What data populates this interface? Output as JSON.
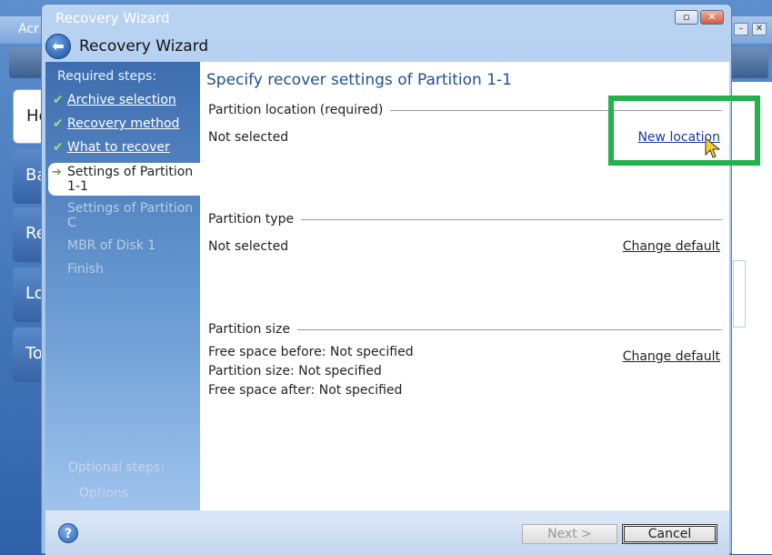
{
  "background_app": {
    "title": "Acr",
    "side_buttons": [
      "He",
      "Ba",
      "Re",
      "Lo",
      "To"
    ]
  },
  "window": {
    "title": "Recovery Wizard",
    "heading": "Recovery Wizard"
  },
  "steps": {
    "heading": "Required steps:",
    "items": [
      {
        "label": "Archive selection",
        "state": "done"
      },
      {
        "label": "Recovery method",
        "state": "done"
      },
      {
        "label": "What to recover",
        "state": "done"
      },
      {
        "label": "Settings of Partition 1-1",
        "state": "current"
      },
      {
        "label": "Settings of Partition C",
        "state": "future"
      },
      {
        "label": "MBR of Disk 1",
        "state": "future"
      },
      {
        "label": "Finish",
        "state": "future"
      }
    ],
    "optional_heading": "Optional steps:",
    "optional_item": "Options"
  },
  "content": {
    "title": "Specify recover settings of Partition 1-1",
    "sections": {
      "location": {
        "label": "Partition location (required)",
        "value": "Not selected",
        "link": "New location"
      },
      "type": {
        "label": "Partition type",
        "value": "Not selected",
        "link": "Change default"
      },
      "size": {
        "label": "Partition size",
        "free_before": "Free space before: Not specified",
        "size": "Partition size: Not specified",
        "free_after": "Free space after: Not specified",
        "link": "Change default"
      }
    }
  },
  "footer": {
    "help_icon": "?",
    "next": "Next >",
    "cancel": "Cancel"
  },
  "colors": {
    "highlight": "#22b14c",
    "heading_blue": "#1f4f96"
  }
}
